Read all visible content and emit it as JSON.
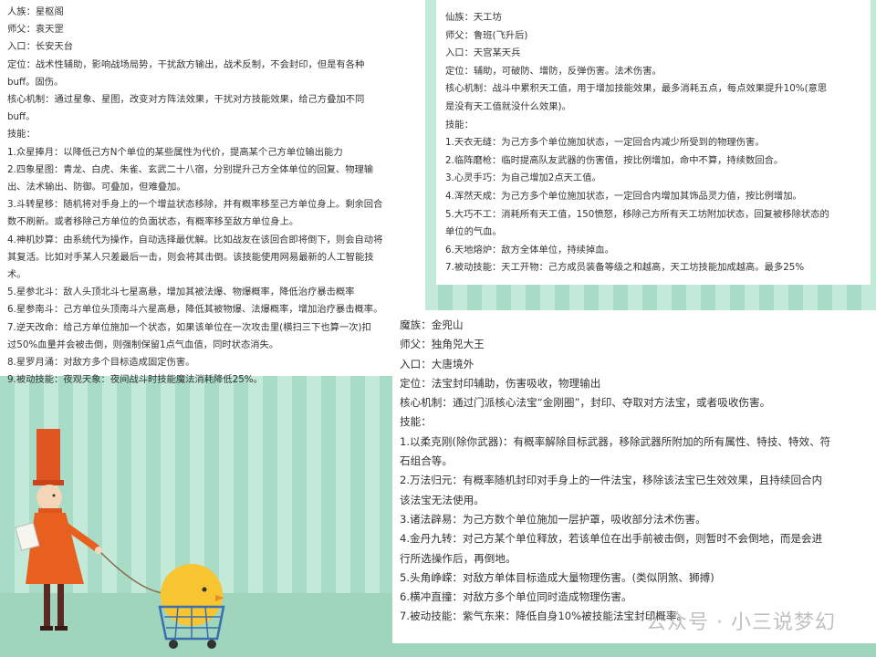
{
  "panel_left": {
    "race": "人族：星枢阁",
    "master": "师父：袁天罡",
    "entrance": "入口：长安天台",
    "position": "定位：战术性辅助，影响战场局势，干扰敌方输出，战术反制，不会封印，但是有各种",
    "position_cont": "buff。固伤。",
    "core": "核心机制：通过星象、星图，改变对方阵法效果，干扰对方技能效果，给己方叠加不同",
    "core_cont": "buff。",
    "skills_title": "技能：",
    "skills": [
      "1.众星捧月：以降低己方N个单位的某些属性为代价，提高某个己方单位输出能力",
      "2.四象星图：青龙、白虎、朱雀、玄武二十八宿，分别提升己方全体单位的回复、物理输",
      "出、法术输出、防御。可叠加，但难叠加。",
      "3.斗转星移：随机将对手身上的一个增益状态移除，并有概率移至己方单位身上。剩余回合",
      "数不刷新。或者移除己方单位的负面状态，有概率移至敌方单位身上。",
      "4.神机妙算：由系统代为操作，自动选择最优解。比如战友在该回合即将倒下，则会自动将",
      "其复活。比如对手某人只差最后一击，则会将其击倒。该技能使用网易最新的人工智能技",
      "术。",
      "5.星参北斗：敌人头顶北斗七星高悬，增加其被法爆、物爆概率，降低治疗暴击概率",
      "6.星参南斗：己方单位头顶南斗六星高悬，降低其被物爆、法爆概率，增加治疗暴击概率。",
      "7.逆天改命：给己方单位施加一个状态，如果该单位在一次攻击里(横扫三下也算一次)扣",
      "过50%血量并会被击倒，则强制保留1点气血值，同时状态消失。",
      "8.星罗月涌：对敌方多个目标造成固定伤害。",
      "9.被动技能：夜观天象：夜间战斗时技能魔法消耗降低25%。"
    ]
  },
  "panel_right": {
    "race": "仙族：天工坊",
    "master": "师父：鲁班(飞升后)",
    "entrance": "入口：天宫某天兵",
    "position": "定位：辅助，可破防、增防，反弹伤害。法术伤害。",
    "core": "核心机制：战斗中累积天工值，用于增加技能效果，最多消耗五点，每点效果提升10%(意思",
    "core_cont": "是没有天工值就没什么效果)。",
    "skills_title": "技能：",
    "skills": [
      "1.天衣无缝：为己方多个单位施加状态，一定回合内减少所受到的物理伤害。",
      "2.临阵磨枪：临时提高队友武器的伤害值，按比例增加，命中不算，持续数回合。",
      "3.心灵手巧：为自己增加2点天工值。",
      "4.浑然天成：为己方多个单位施加状态，一定回合内增加其饰品灵力值，按比例增加。",
      "5.大巧不工：消耗所有天工值，150愤怒，移除己方所有天工坊附加状态，回复被移除状态的",
      "单位的气血。",
      "6.天地熔炉：敌方全体单位，持续掉血。",
      "7.被动技能：天工开物：己方成员装备等级之和越高，天工坊技能加成越高。最多25%"
    ]
  },
  "panel_bottom": {
    "race": "魔族：金兜山",
    "master": "师父：独角兕大王",
    "entrance": "入口：大唐境外",
    "position": "定位：法宝封印辅助，伤害吸收，物理输出",
    "core": "核心机制：通过门派核心法宝“金刚圈”，封印、夺取对方法宝，或者吸收伤害。",
    "skills_title": "技能：",
    "skills": [
      "1.以柔克刚(除你武器)：有概率解除目标武器，移除武器所附加的所有属性、特技、特效、符",
      "石组合等。",
      "2.万法归元：有概率随机封印对手身上的一件法宝，移除该法宝已生效效果，且持续回合内",
      "该法宝无法使用。",
      "3.诸法辟易：为己方数个单位施加一层护罩，吸收部分法术伤害。",
      "4.金丹九转：对己方某个单位释放，若该单位在出手前被击倒，则暂时不会倒地，而是会进",
      "行所选操作后，再倒地。",
      "5.头角峥嵘：对敌方单体目标造成大量物理伤害。(类似阴煞、狮搏)",
      "6.横冲直撞：对敌方多个单位同时造成物理伤害。",
      "7.被动技能：紫气东来：降低自身10%被技能法宝封印概率。"
    ]
  },
  "watermark": "公众号 · 小三说梦幻",
  "colors": {
    "stripe_dark": "#a9dcc7",
    "stripe_light": "#c3e9d8",
    "text": "#333333"
  }
}
